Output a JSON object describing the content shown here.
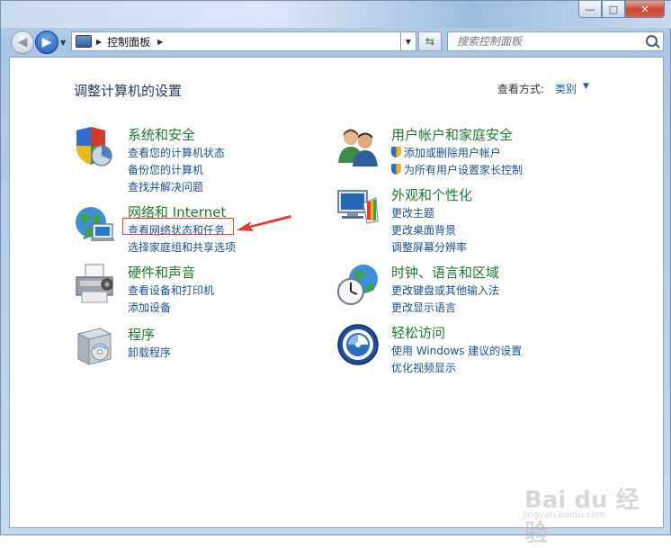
{
  "window": {
    "minimize_glyph": "—",
    "maximize_glyph": "□",
    "close_glyph": "✕"
  },
  "navbar": {
    "address_text": "控制面板",
    "search_placeholder": "搜索控制面板"
  },
  "header": {
    "title": "调整计算机的设置",
    "view_by_label": "查看方式:",
    "view_by_value": "类别"
  },
  "categories": [
    {
      "id": "system-security",
      "title": "系统和安全",
      "icon": "shield-chart-icon",
      "links": [
        "查看您的计算机状态",
        "备份您的计算机",
        "查找并解决问题"
      ]
    },
    {
      "id": "network",
      "title": "网络和 Internet",
      "icon": "globe-network-icon",
      "links": [
        "查看网络状态和任务",
        "选择家庭组和共享选项"
      ]
    },
    {
      "id": "hardware",
      "title": "硬件和声音",
      "icon": "printer-icon",
      "links": [
        "查看设备和打印机",
        "添加设备"
      ]
    },
    {
      "id": "programs",
      "title": "程序",
      "icon": "programs-box-icon",
      "links": [
        "卸载程序"
      ]
    },
    {
      "id": "user-accounts",
      "title": "用户帐户和家庭安全",
      "icon": "users-icon",
      "links": [
        "添加或删除用户帐户",
        "为所有用户设置家长控制"
      ]
    },
    {
      "id": "appearance",
      "title": "外观和个性化",
      "icon": "monitor-palette-icon",
      "links": [
        "更改主题",
        "更改桌面背景",
        "调整屏幕分辨率"
      ]
    },
    {
      "id": "clock",
      "title": "时钟、语言和区域",
      "icon": "clock-globe-icon",
      "links": [
        "更改键盘或其他输入法",
        "更改显示语言"
      ]
    },
    {
      "id": "ease",
      "title": "轻松访问",
      "icon": "ease-of-access-icon",
      "links": [
        "使用 Windows 建议的设置",
        "优化视频显示"
      ]
    }
  ],
  "watermark": {
    "text": "Bai du 经验",
    "sub": "jingyan.baidu.com"
  },
  "colors": {
    "accent": "#1a4f8f",
    "category_title": "#1e7a2e",
    "highlight": "#e53935"
  }
}
